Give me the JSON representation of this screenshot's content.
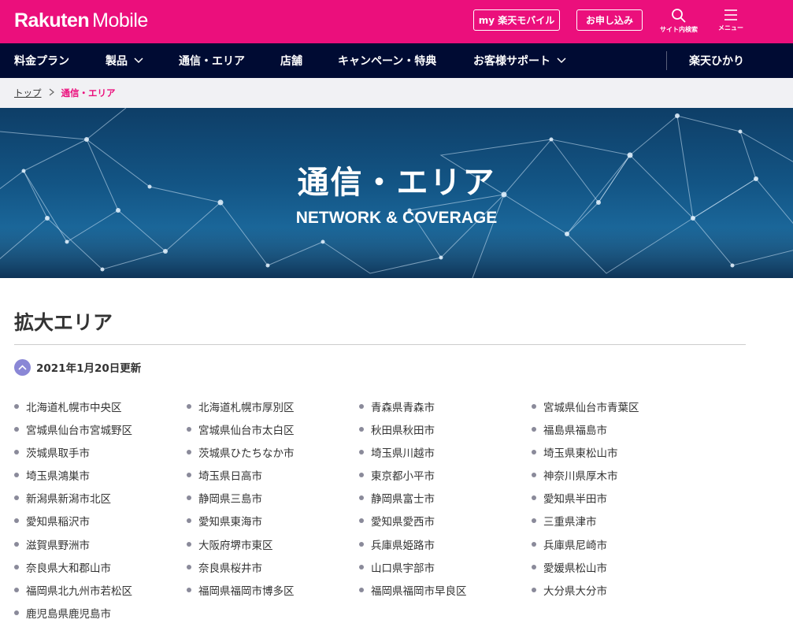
{
  "header": {
    "brand": "Rakuten",
    "brand_suffix": "Mobile",
    "my_button": "my 楽天モバイル",
    "apply_button": "お申し込み",
    "search_label": "サイト内検索",
    "menu_label": "メニュー",
    "accent_color": "#eb0f7c"
  },
  "nav": {
    "items": [
      "料金プラン",
      "製品",
      "通信・エリア",
      "店舗",
      "キャンペーン・特典",
      "お客様サポート",
      "楽天ひかり"
    ],
    "background": "#000b33"
  },
  "breadcrumb": {
    "top": "トップ",
    "current": "通信・エリア"
  },
  "hero": {
    "title": "通信・エリア",
    "subtitle": "NETWORK & COVERAGE"
  },
  "section": {
    "title": "拡大エリア",
    "update_label": "2021年1月20日更新",
    "areas": [
      "北海道札幌市中央区",
      "北海道札幌市厚別区",
      "青森県青森市",
      "宮城県仙台市青葉区",
      "宮城県仙台市宮城野区",
      "宮城県仙台市太白区",
      "秋田県秋田市",
      "福島県福島市",
      "茨城県取手市",
      "茨城県ひたちなか市",
      "埼玉県川越市",
      "埼玉県東松山市",
      "埼玉県鴻巣市",
      "埼玉県日高市",
      "東京都小平市",
      "神奈川県厚木市",
      "新潟県新潟市北区",
      "静岡県三島市",
      "静岡県富士市",
      "愛知県半田市",
      "愛知県稲沢市",
      "愛知県東海市",
      "愛知県愛西市",
      "三重県津市",
      "滋賀県野洲市",
      "大阪府堺市東区",
      "兵庫県姫路市",
      "兵庫県尼崎市",
      "奈良県大和郡山市",
      "奈良県桜井市",
      "山口県宇部市",
      "愛媛県松山市",
      "福岡県北九州市若松区",
      "福岡県福岡市博多区",
      "福岡県福岡市早良区",
      "大分県大分市",
      "鹿児島県鹿児島市"
    ]
  }
}
